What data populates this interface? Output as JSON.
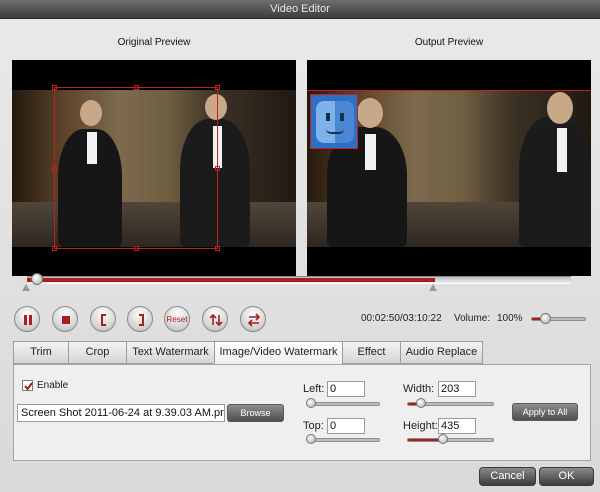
{
  "window": {
    "title": "Video Editor"
  },
  "preview": {
    "original_label": "Original Preview",
    "output_label": "Output Preview"
  },
  "timeline": {
    "progress": 0.75,
    "thumb_position": 0.02
  },
  "controls": {
    "reset_label": "Reset",
    "timecode": "00:02:50/03:10:22",
    "volume_label": "Volume:",
    "volume_value": "100%",
    "volume_level": 1.0
  },
  "tabs": [
    {
      "label": "Trim"
    },
    {
      "label": "Crop"
    },
    {
      "label": "Text Watermark"
    },
    {
      "label": "Image/Video Watermark",
      "active": true
    },
    {
      "label": "Effect"
    },
    {
      "label": "Audio Replace"
    }
  ],
  "watermark": {
    "enable_label": "Enable",
    "enabled": true,
    "file_value": "Screen Shot 2011-06-24 at 9.39.03 AM.png",
    "browse_label": "Browse",
    "left_label": "Left:",
    "left_value": "0",
    "top_label": "Top:",
    "top_value": "0",
    "width_label": "Width:",
    "width_value": "203",
    "height_label": "Height:",
    "height_value": "435",
    "apply_all_label": "Apply to All"
  },
  "footer": {
    "cancel_label": "Cancel",
    "ok_label": "OK"
  },
  "colors": {
    "accent": "#a91d1d",
    "crop_border": "#c42020"
  }
}
